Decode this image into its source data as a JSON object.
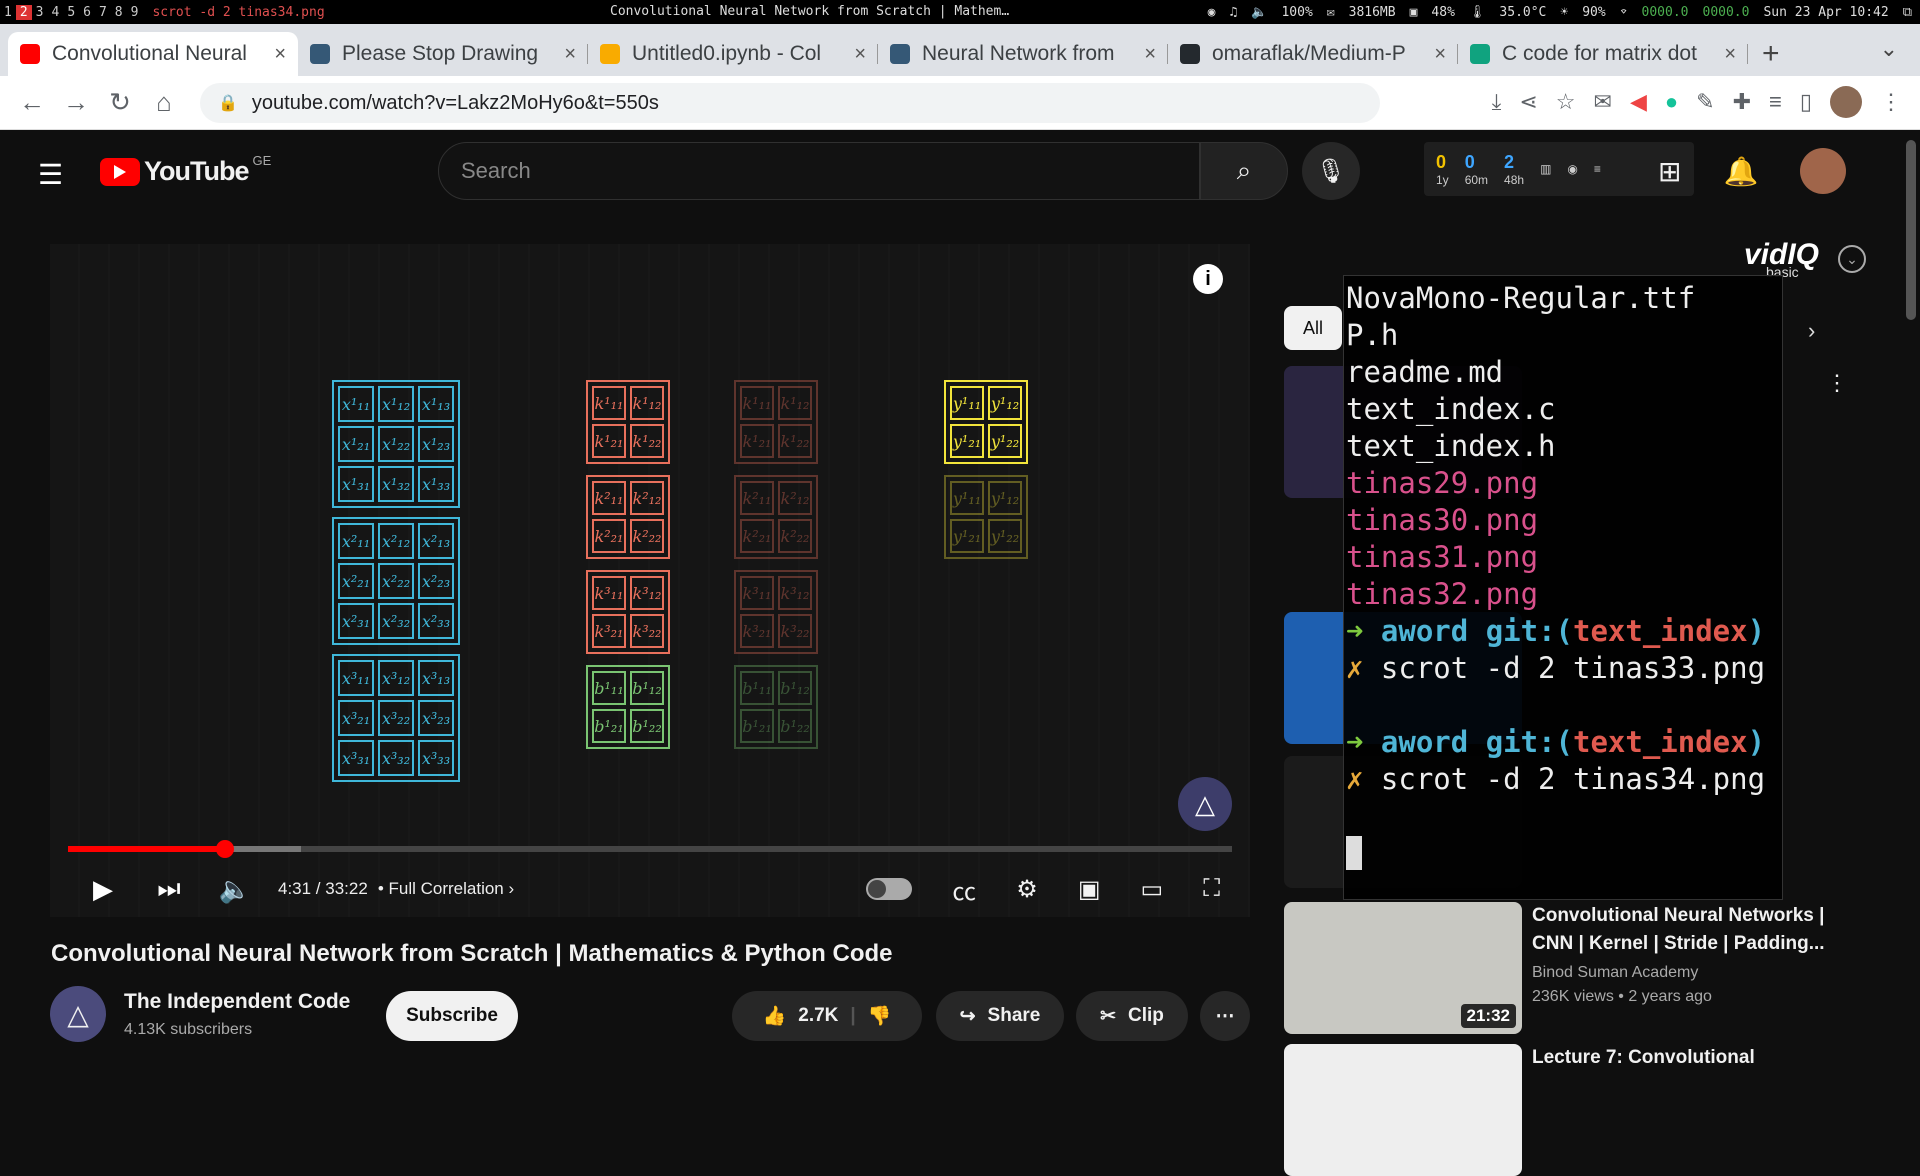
{
  "sysbar": {
    "workspaces": [
      "1",
      "2",
      "3",
      "4",
      "5",
      "6",
      "7",
      "8",
      "9"
    ],
    "active_workspace": "2",
    "command": "scrot -d 2 tinas34.png",
    "window_title": "Convolutional Neural Network from Scratch | Mathem…",
    "volume": "100%",
    "mem": "3816MB",
    "cpu": "48%",
    "temp": "35.0°C",
    "brightness": "90%",
    "net_down": "0000.0",
    "net_up": "0000.0",
    "datetime": "Sun 23 Apr 10:42"
  },
  "browser": {
    "tabs": [
      {
        "title": "Convolutional Neural",
        "favicon": "youtube-icon",
        "color": "#ff0000",
        "active": true
      },
      {
        "title": "Please Stop Drawing",
        "favicon": "tds-icon",
        "color": "#355876",
        "active": false
      },
      {
        "title": "Untitled0.ipynb - Col",
        "favicon": "colab-icon",
        "color": "#f9ab00",
        "active": false
      },
      {
        "title": "Neural Network from",
        "favicon": "tds-icon",
        "color": "#355876",
        "active": false
      },
      {
        "title": "omaraflak/Medium-P",
        "favicon": "github-icon",
        "color": "#24292e",
        "active": false
      },
      {
        "title": "C code for matrix dot",
        "favicon": "chatgpt-icon",
        "color": "#10a37f",
        "active": false
      }
    ],
    "url": "youtube.com/watch?v=Lakz2MoHy6o&t=550s"
  },
  "youtube": {
    "country": "GE",
    "search_placeholder": "Search",
    "stats": [
      {
        "value": "0",
        "label": "1y",
        "color": "#f2c200"
      },
      {
        "value": "0",
        "label": "60m",
        "color": "#3ea6ff"
      },
      {
        "value": "2",
        "label": "48h",
        "color": "#3ea6ff"
      }
    ]
  },
  "player": {
    "time": "4:31 / 33:22",
    "chapter": "Full Correlation",
    "progress_fraction": 0.135,
    "buffered_fraction": 0.2
  },
  "diagram": {
    "x_labels": [
      [
        "x¹₁₁",
        "x¹₁₂",
        "x¹₁₃",
        "x¹₂₁",
        "x¹₂₂",
        "x¹₂₃",
        "x¹₃₁",
        "x¹₃₂",
        "x¹₃₃"
      ],
      [
        "x²₁₁",
        "x²₁₂",
        "x²₁₃",
        "x²₂₁",
        "x²₂₂",
        "x²₂₃",
        "x²₃₁",
        "x²₃₂",
        "x²₃₃"
      ],
      [
        "x³₁₁",
        "x³₁₂",
        "x³₁₃",
        "x³₂₁",
        "x³₂₂",
        "x³₂₃",
        "x³₃₁",
        "x³₃₂",
        "x³₃₃"
      ]
    ],
    "k_labels": [
      [
        "k¹₁₁",
        "k¹₁₂",
        "k¹₂₁",
        "k¹₂₂"
      ],
      [
        "k²₁₁",
        "k²₁₂",
        "k²₂₁",
        "k²₂₂"
      ],
      [
        "k³₁₁",
        "k³₁₂",
        "k³₂₁",
        "k³₂₂"
      ]
    ],
    "b_labels": [
      "b¹₁₁",
      "b¹₁₂",
      "b¹₂₁",
      "b¹₂₂"
    ],
    "y_labels": [
      "y¹₁₁",
      "y¹₁₂",
      "y¹₂₁",
      "y¹₂₂"
    ],
    "colors": {
      "x": "#3fb7d9",
      "k": "#e8705c",
      "b": "#7ac472",
      "y": "#f2e43b"
    }
  },
  "video": {
    "title": "Convolutional Neural Network from Scratch | Mathematics & Python Code",
    "channel": "The Independent Code",
    "subscribers": "4.13K subscribers",
    "subscribe_label": "Subscribe",
    "likes": "2.7K",
    "share_label": "Share",
    "clip_label": "Clip"
  },
  "sidebar": {
    "vidiq": "vidIQ",
    "vidiq_plan": "basic",
    "chip_all": "All",
    "recommendations": [
      {
        "title": "Convolutional Neural Networks | CNN | Kernel | Stride | Padding...",
        "channel": "Binod Suman Academy",
        "meta": "236K views • 2 years ago",
        "duration": "21:32"
      },
      {
        "title": "Lecture 7: Convolutional",
        "channel": "",
        "meta": "",
        "duration": ""
      }
    ]
  },
  "terminal": {
    "lines": [
      "NovaMono-Regular.ttf",
      "P.h",
      "readme.md",
      "text_index.c",
      "text_index.h"
    ],
    "png_lines": [
      "tinas29.png",
      "tinas30.png",
      "tinas31.png",
      "tinas32.png"
    ],
    "prompt_dir": "aword",
    "git_label": "git:(",
    "branch": "text_index",
    "git_close": ")",
    "arrow": "➜",
    "cross": "✗",
    "cmd1": "scrot -d 2 tinas33.png",
    "cmd2": "scrot -d 2 tinas34.png"
  }
}
